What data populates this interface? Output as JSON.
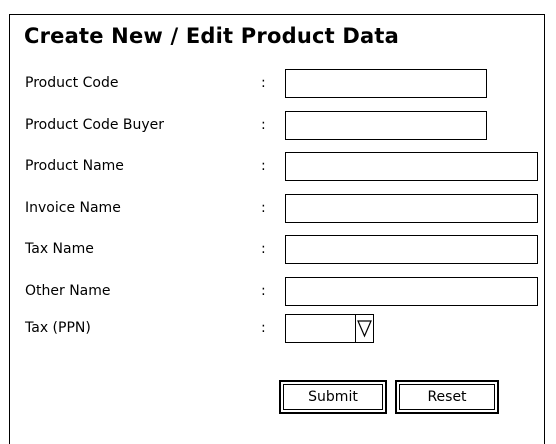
{
  "form": {
    "title": "Create New / Edit Product Data",
    "colon": ":",
    "fields": [
      {
        "label": "Product Code",
        "value": "",
        "placeholder": ""
      },
      {
        "label": "Product Code Buyer",
        "value": "",
        "placeholder": ""
      },
      {
        "label": "Product Name",
        "value": "",
        "placeholder": ""
      },
      {
        "label": "Invoice Name",
        "value": "",
        "placeholder": ""
      },
      {
        "label": "Tax Name",
        "value": "",
        "placeholder": ""
      },
      {
        "label": "Other Name",
        "value": "",
        "placeholder": ""
      }
    ],
    "tax": {
      "label": "Tax (PPN)",
      "selected": "",
      "arrow_icon": "triangle-down-icon"
    },
    "buttons": {
      "submit_label": "Submit",
      "reset_label": "Reset"
    }
  }
}
